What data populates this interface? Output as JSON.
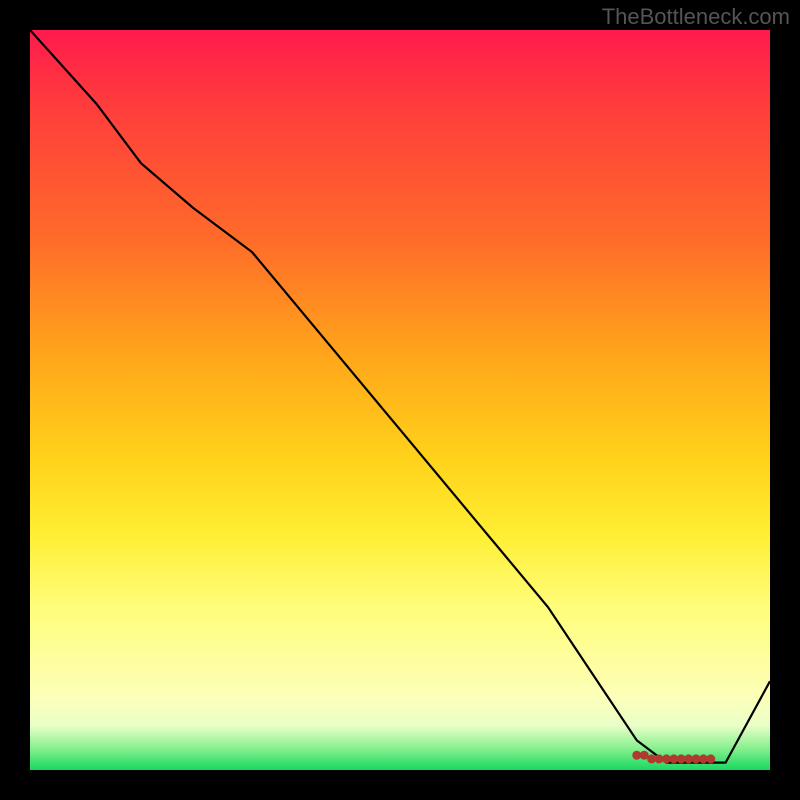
{
  "attribution": "TheBottleneck.com",
  "colors": {
    "attribution": "#555555",
    "curve": "#000000",
    "marker_fill": "#b03a2e",
    "gradient_top": "#ff1a4d",
    "gradient_bottom": "#18d85f"
  },
  "chart_data": {
    "type": "line",
    "title": "",
    "xlabel": "",
    "ylabel": "",
    "xlim": [
      0,
      100
    ],
    "ylim": [
      0,
      100
    ],
    "grid": false,
    "legend": false,
    "x": [
      0,
      9,
      15,
      22,
      30,
      40,
      50,
      60,
      70,
      78,
      82,
      86,
      90,
      94,
      100
    ],
    "values": [
      100,
      90,
      82,
      76,
      70,
      58,
      46,
      34,
      22,
      10,
      4,
      1,
      1,
      1,
      12
    ],
    "notes": "y is a unitless metric (0 best at bottom, 100 worst at top). Background encodes value via color. Red markers near the curve minimum highlight optimal x-range ~82–92.",
    "markers": [
      {
        "x": 82,
        "y": 2
      },
      {
        "x": 83,
        "y": 2
      },
      {
        "x": 84,
        "y": 1.5
      },
      {
        "x": 85,
        "y": 1.5
      },
      {
        "x": 86,
        "y": 1.5
      },
      {
        "x": 87,
        "y": 1.5
      },
      {
        "x": 88,
        "y": 1.5
      },
      {
        "x": 89,
        "y": 1.5
      },
      {
        "x": 90,
        "y": 1.5
      },
      {
        "x": 91,
        "y": 1.5
      },
      {
        "x": 92,
        "y": 1.5
      }
    ]
  }
}
